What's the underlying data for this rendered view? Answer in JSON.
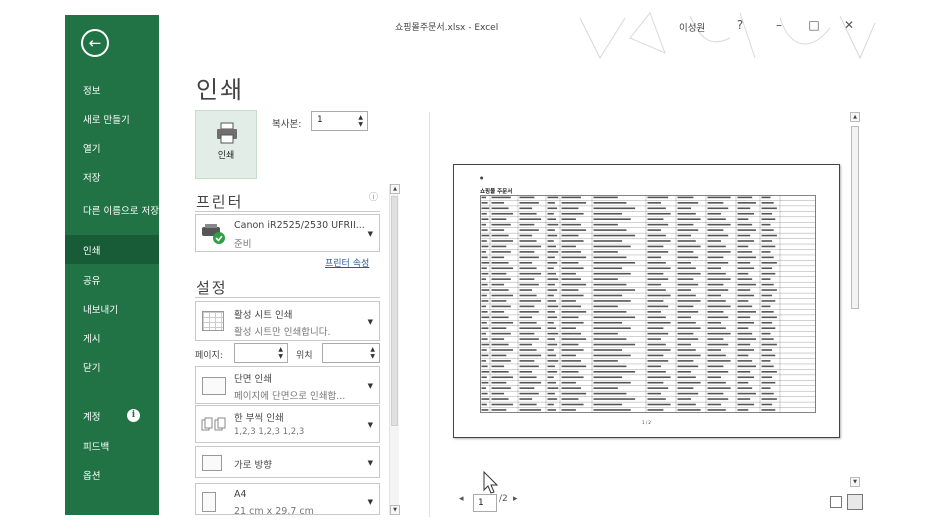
{
  "window": {
    "title": "쇼핑몰주문서.xlsx - Excel",
    "user": "이성원",
    "help": "?",
    "minimize": "–",
    "restore": "□",
    "close": "✕"
  },
  "sidebar": {
    "back_icon": "←",
    "items": [
      {
        "label": "정보"
      },
      {
        "label": "새로 만들기"
      },
      {
        "label": "열기"
      },
      {
        "label": "저장"
      },
      {
        "label": "다른 이름으로 저장"
      },
      {
        "label": "인쇄"
      },
      {
        "label": "공유"
      },
      {
        "label": "내보내기"
      },
      {
        "label": "게시"
      },
      {
        "label": "닫기"
      },
      {
        "label": "계정"
      },
      {
        "label": "피드백"
      },
      {
        "label": "옵션"
      }
    ],
    "account_info_icon": "i"
  },
  "print": {
    "title": "인쇄",
    "print_button": "인쇄",
    "copies_label": "복사본:",
    "copies_value": "1"
  },
  "printer": {
    "section_title": "프린터",
    "name": "Canon iR2525/2530 UFRII...",
    "status": "준비",
    "properties_link": "프린터 속성",
    "info_icon": "ⓘ"
  },
  "settings": {
    "section_title": "설정",
    "scope_title": "활성 시트 인쇄",
    "scope_desc": "활성 시트만 인쇄합니다.",
    "pages_label": "페이지:",
    "to_label": "위치",
    "sides_title": "단면 인쇄",
    "sides_desc": "페이지에 단면으로 인쇄합...",
    "collate_title": "한 부씩 인쇄",
    "collate_desc": "1,2,3    1,2,3    1,2,3",
    "orientation": "가로 방향",
    "paper_title": "A4",
    "paper_desc": "21 cm x 29.7 cm"
  },
  "preview": {
    "sheet_title": "쇼핑몰 주문서",
    "page_footer": "1 / 2",
    "current_page": "1",
    "total_pages": "/2"
  },
  "colors": {
    "sidebar": "#217346",
    "sidebar_active": "#185c37",
    "link": "#2b579a"
  }
}
